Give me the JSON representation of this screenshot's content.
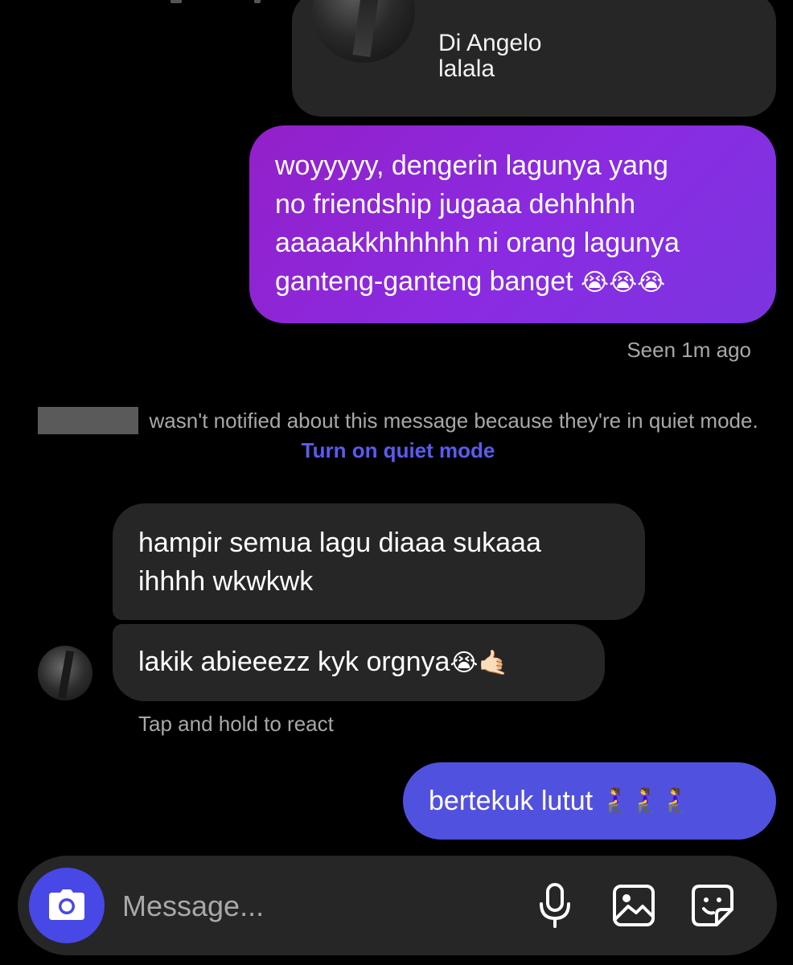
{
  "shared_post": {
    "title": "Di Angelo",
    "subtitle": "lalala"
  },
  "messages": {
    "outgoing_1": {
      "lines": [
        "woyyyyy, dengerin lagunya yang",
        "no friendship jugaaa dehhhhh",
        "aaaaakkhhhhhh ni orang lagunya",
        "ganteng-ganteng banget"
      ],
      "emoji": "😭😭😭"
    },
    "seen_status": "Seen 1m ago",
    "quiet_notice": {
      "text": "wasn't notified about this message because they're in quiet mode.",
      "link_label": "Turn on quiet mode"
    },
    "incoming_1": {
      "lines": [
        "hampir semua lagu diaaa sukaaa",
        "ihhhh wkwkwk"
      ]
    },
    "incoming_2": {
      "text": "lakik abieeezz kyk orgnya",
      "emoji": "😭🤙🏻"
    },
    "react_hint": "Tap and hold to react",
    "outgoing_2": {
      "text": "bertekuk lutut",
      "emoji": "🧎‍♀️🧎‍♀️🧎‍♀️"
    }
  },
  "composer": {
    "placeholder": "Message...",
    "value": ""
  },
  "icons": {
    "camera": "camera-icon",
    "mic": "microphone-icon",
    "gallery": "image-gallery-icon",
    "sticker": "sticker-icon"
  },
  "colors": {
    "background": "#000000",
    "outgoing_gradient_start": "#9320c9",
    "outgoing_gradient_end": "#7b35e0",
    "outgoing_blue": "#5151e0",
    "incoming_bubble": "#262626",
    "link": "#5b5bf0",
    "muted_text": "#a8a8a8"
  }
}
